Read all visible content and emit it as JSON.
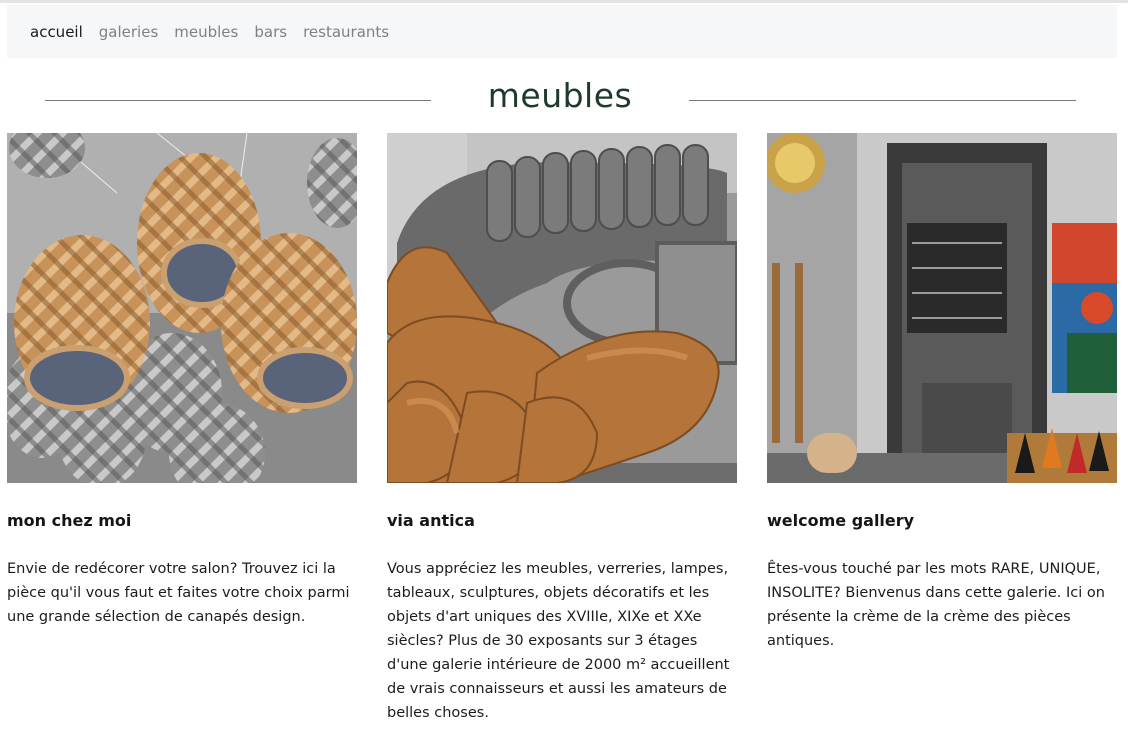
{
  "nav": {
    "items": [
      {
        "label": "accueil",
        "active": true
      },
      {
        "label": "galeries",
        "active": false
      },
      {
        "label": "meubles",
        "active": false
      },
      {
        "label": "bars",
        "active": false
      },
      {
        "label": "restaurants",
        "active": false
      }
    ]
  },
  "section": {
    "title": "meubles"
  },
  "cards": [
    {
      "title": "mon chez moi",
      "text": "Envie de redécorer votre salon? Trouvez ici la pièce qu'il vous faut et faites votre choix parmi une grande sélection de canapés design.",
      "image": "wicker-pendant-lamps-photo"
    },
    {
      "title": "via antica",
      "text": "Vous appréciez les meubles, verreries, lampes, tableaux, sculptures, objets décoratifs et les objets d'art uniques des XVIIIe, XIXe et XXe siècles? Plus de 30 exposants sur 3 étages d'une galerie intérieure de 2000 m² accueillent de vrais connaisseurs et aussi les amateurs de belles choses.",
      "image": "leather-sofa-photo"
    },
    {
      "title": "welcome gallery",
      "text": "Êtes-vous touché par les mots RARE, UNIQUE, INSOLITE? Bienvenus dans cette galerie. Ici on présente la crème de la crème des pièces antiques.",
      "image": "gallery-interior-photo"
    }
  ],
  "colors": {
    "accent_title": "#1d3a2a",
    "nav_bg": "#f6f7f9",
    "nav_inactive": "#808080"
  }
}
